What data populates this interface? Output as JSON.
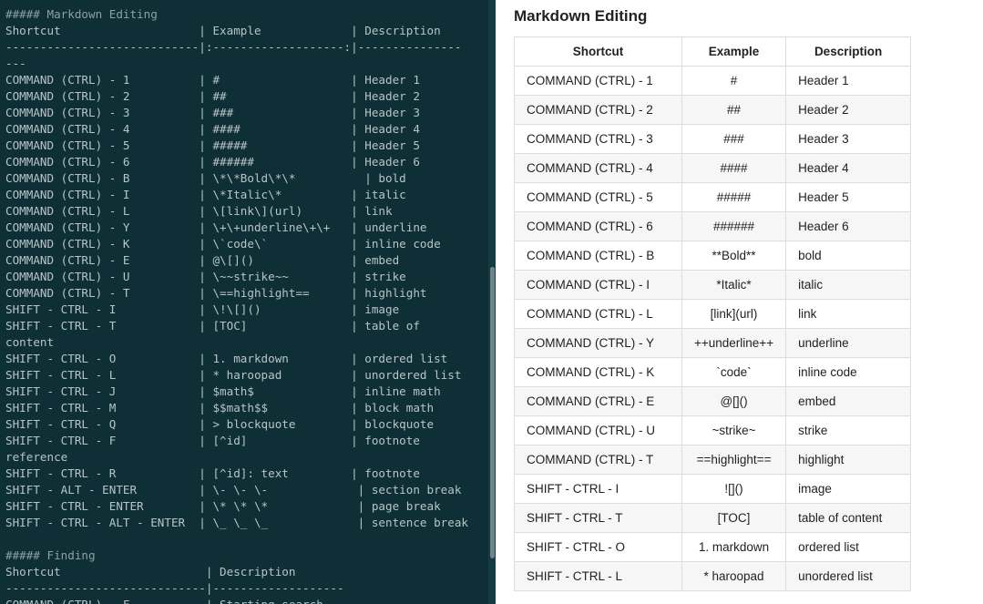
{
  "editor": {
    "lines": [
      "##### Markdown Editing",
      "Shortcut                    | Example             | Description",
      "----------------------------|:-------------------:|---------------",
      "---",
      "COMMAND (CTRL) - 1          | #                   | Header 1",
      "COMMAND (CTRL) - 2          | ##                  | Header 2",
      "COMMAND (CTRL) - 3          | ###                 | Header 3",
      "COMMAND (CTRL) - 4          | ####                | Header 4",
      "COMMAND (CTRL) - 5          | #####               | Header 5",
      "COMMAND (CTRL) - 6          | ######              | Header 6",
      "COMMAND (CTRL) - B          | \\*\\*Bold\\*\\*          | bold",
      "COMMAND (CTRL) - I          | \\*Italic\\*          | italic",
      "COMMAND (CTRL) - L          | \\[link\\](url)       | link",
      "COMMAND (CTRL) - Y          | \\+\\+underline\\+\\+   | underline",
      "COMMAND (CTRL) - K          | \\`code\\`            | inline code",
      "COMMAND (CTRL) - E          | @\\[]()              | embed",
      "COMMAND (CTRL) - U          | \\~~strike~~         | strike",
      "COMMAND (CTRL) - T          | \\==highlight==      | highlight",
      "SHIFT - CTRL - I            | \\!\\[]()             | image",
      "SHIFT - CTRL - T            | [TOC]               | table of",
      "content",
      "SHIFT - CTRL - O            | 1. markdown         | ordered list",
      "SHIFT - CTRL - L            | * haroopad          | unordered list",
      "SHIFT - CTRL - J            | $math$              | inline math",
      "SHIFT - CTRL - M            | $$math$$            | block math",
      "SHIFT - CTRL - Q            | > blockquote        | blockquote",
      "SHIFT - CTRL - F            | [^id]               | footnote",
      "reference",
      "SHIFT - CTRL - R            | [^id]: text         | footnote",
      "SHIFT - ALT - ENTER         | \\- \\- \\-             | section break",
      "SHIFT - CTRL - ENTER        | \\* \\* \\*             | page break",
      "SHIFT - CTRL - ALT - ENTER  | \\_ \\_ \\_             | sentence break",
      "",
      "##### Finding",
      "Shortcut                     | Description",
      "-----------------------------|-------------------",
      "COMMAND (CTRL) - F           | Starting search"
    ]
  },
  "preview": {
    "title": "Markdown Editing",
    "headers": [
      "Shortcut",
      "Example",
      "Description"
    ],
    "rows": [
      [
        "COMMAND (CTRL) - 1",
        "#",
        "Header 1"
      ],
      [
        "COMMAND (CTRL) - 2",
        "##",
        "Header 2"
      ],
      [
        "COMMAND (CTRL) - 3",
        "###",
        "Header 3"
      ],
      [
        "COMMAND (CTRL) - 4",
        "####",
        "Header 4"
      ],
      [
        "COMMAND (CTRL) - 5",
        "#####",
        "Header 5"
      ],
      [
        "COMMAND (CTRL) - 6",
        "######",
        "Header 6"
      ],
      [
        "COMMAND (CTRL) - B",
        "**Bold**",
        "bold"
      ],
      [
        "COMMAND (CTRL) - I",
        "*Italic*",
        "italic"
      ],
      [
        "COMMAND (CTRL) - L",
        "[link](url)",
        "link"
      ],
      [
        "COMMAND (CTRL) - Y",
        "++underline++",
        "underline"
      ],
      [
        "COMMAND (CTRL) - K",
        "`code`",
        "inline code"
      ],
      [
        "COMMAND (CTRL) - E",
        "@[]()",
        "embed"
      ],
      [
        "COMMAND (CTRL) - U",
        "~strike~",
        "strike"
      ],
      [
        "COMMAND (CTRL) - T",
        "==highlight==",
        "highlight"
      ],
      [
        "SHIFT - CTRL - I",
        "![]()",
        "image"
      ],
      [
        "SHIFT - CTRL - T",
        "[TOC]",
        "table of content"
      ],
      [
        "SHIFT - CTRL - O",
        "1. markdown",
        "ordered list"
      ],
      [
        "SHIFT - CTRL - L",
        "* haroopad",
        "unordered list"
      ]
    ]
  },
  "colors": {
    "editor_bg": "#0e2f36",
    "editor_text": "#b9c4c6",
    "table_border": "#dddddd",
    "row_stripe": "#f6f6f6"
  }
}
